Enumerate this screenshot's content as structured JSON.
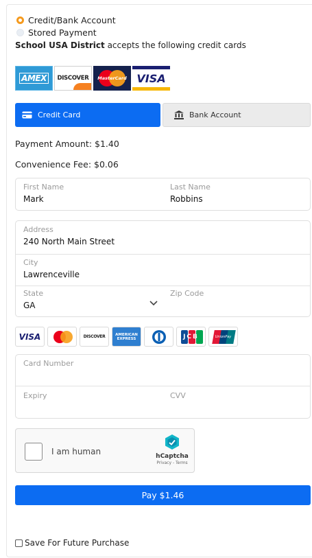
{
  "payment_type": {
    "options": [
      {
        "label": "Credit/Bank Account",
        "selected": true
      },
      {
        "label": "Stored Payment",
        "selected": false
      }
    ]
  },
  "accepts": {
    "district": "School USA District",
    "text": " accepts the following credit cards"
  },
  "brand_logos": {
    "amex": "AMEX",
    "discover": "DISCOVER",
    "mastercard": "MasterCard",
    "visa": "VISA"
  },
  "tabs": {
    "credit": "Credit Card",
    "bank": "Bank Account"
  },
  "amounts": {
    "payment": "Payment Amount: $1.40",
    "fee": "Convenience Fee: $0.06"
  },
  "name_fields": {
    "first_label": "First Name",
    "first_value": "Mark",
    "last_label": "Last Name",
    "last_value": "Robbins"
  },
  "address_fields": {
    "address_label": "Address",
    "address_value": "240 North Main Street",
    "city_label": "City",
    "city_value": "Lawrenceville",
    "state_label": "State",
    "state_value": "GA",
    "zip_label": "Zip Code",
    "zip_value": ""
  },
  "card_logos": {
    "visa": "VISA",
    "discover": "DISCOVER",
    "amex_top": "AMERICAN",
    "amex_bottom": "EXPRESS",
    "jcb": "JCB",
    "unionpay": "UnionPay"
  },
  "card_fields": {
    "number_label": "Card Number",
    "expiry_label": "Expiry",
    "cvv_label": "CVV"
  },
  "captcha": {
    "label": "I am human",
    "brand": "hCaptcha",
    "links": "Privacy - Terms"
  },
  "pay_button": {
    "label": "Pay $1.46"
  },
  "save": {
    "label": "Save For Future Purchase"
  },
  "colors": {
    "accent": "#0c6cf2",
    "radio_selected": "#f59a1e"
  }
}
